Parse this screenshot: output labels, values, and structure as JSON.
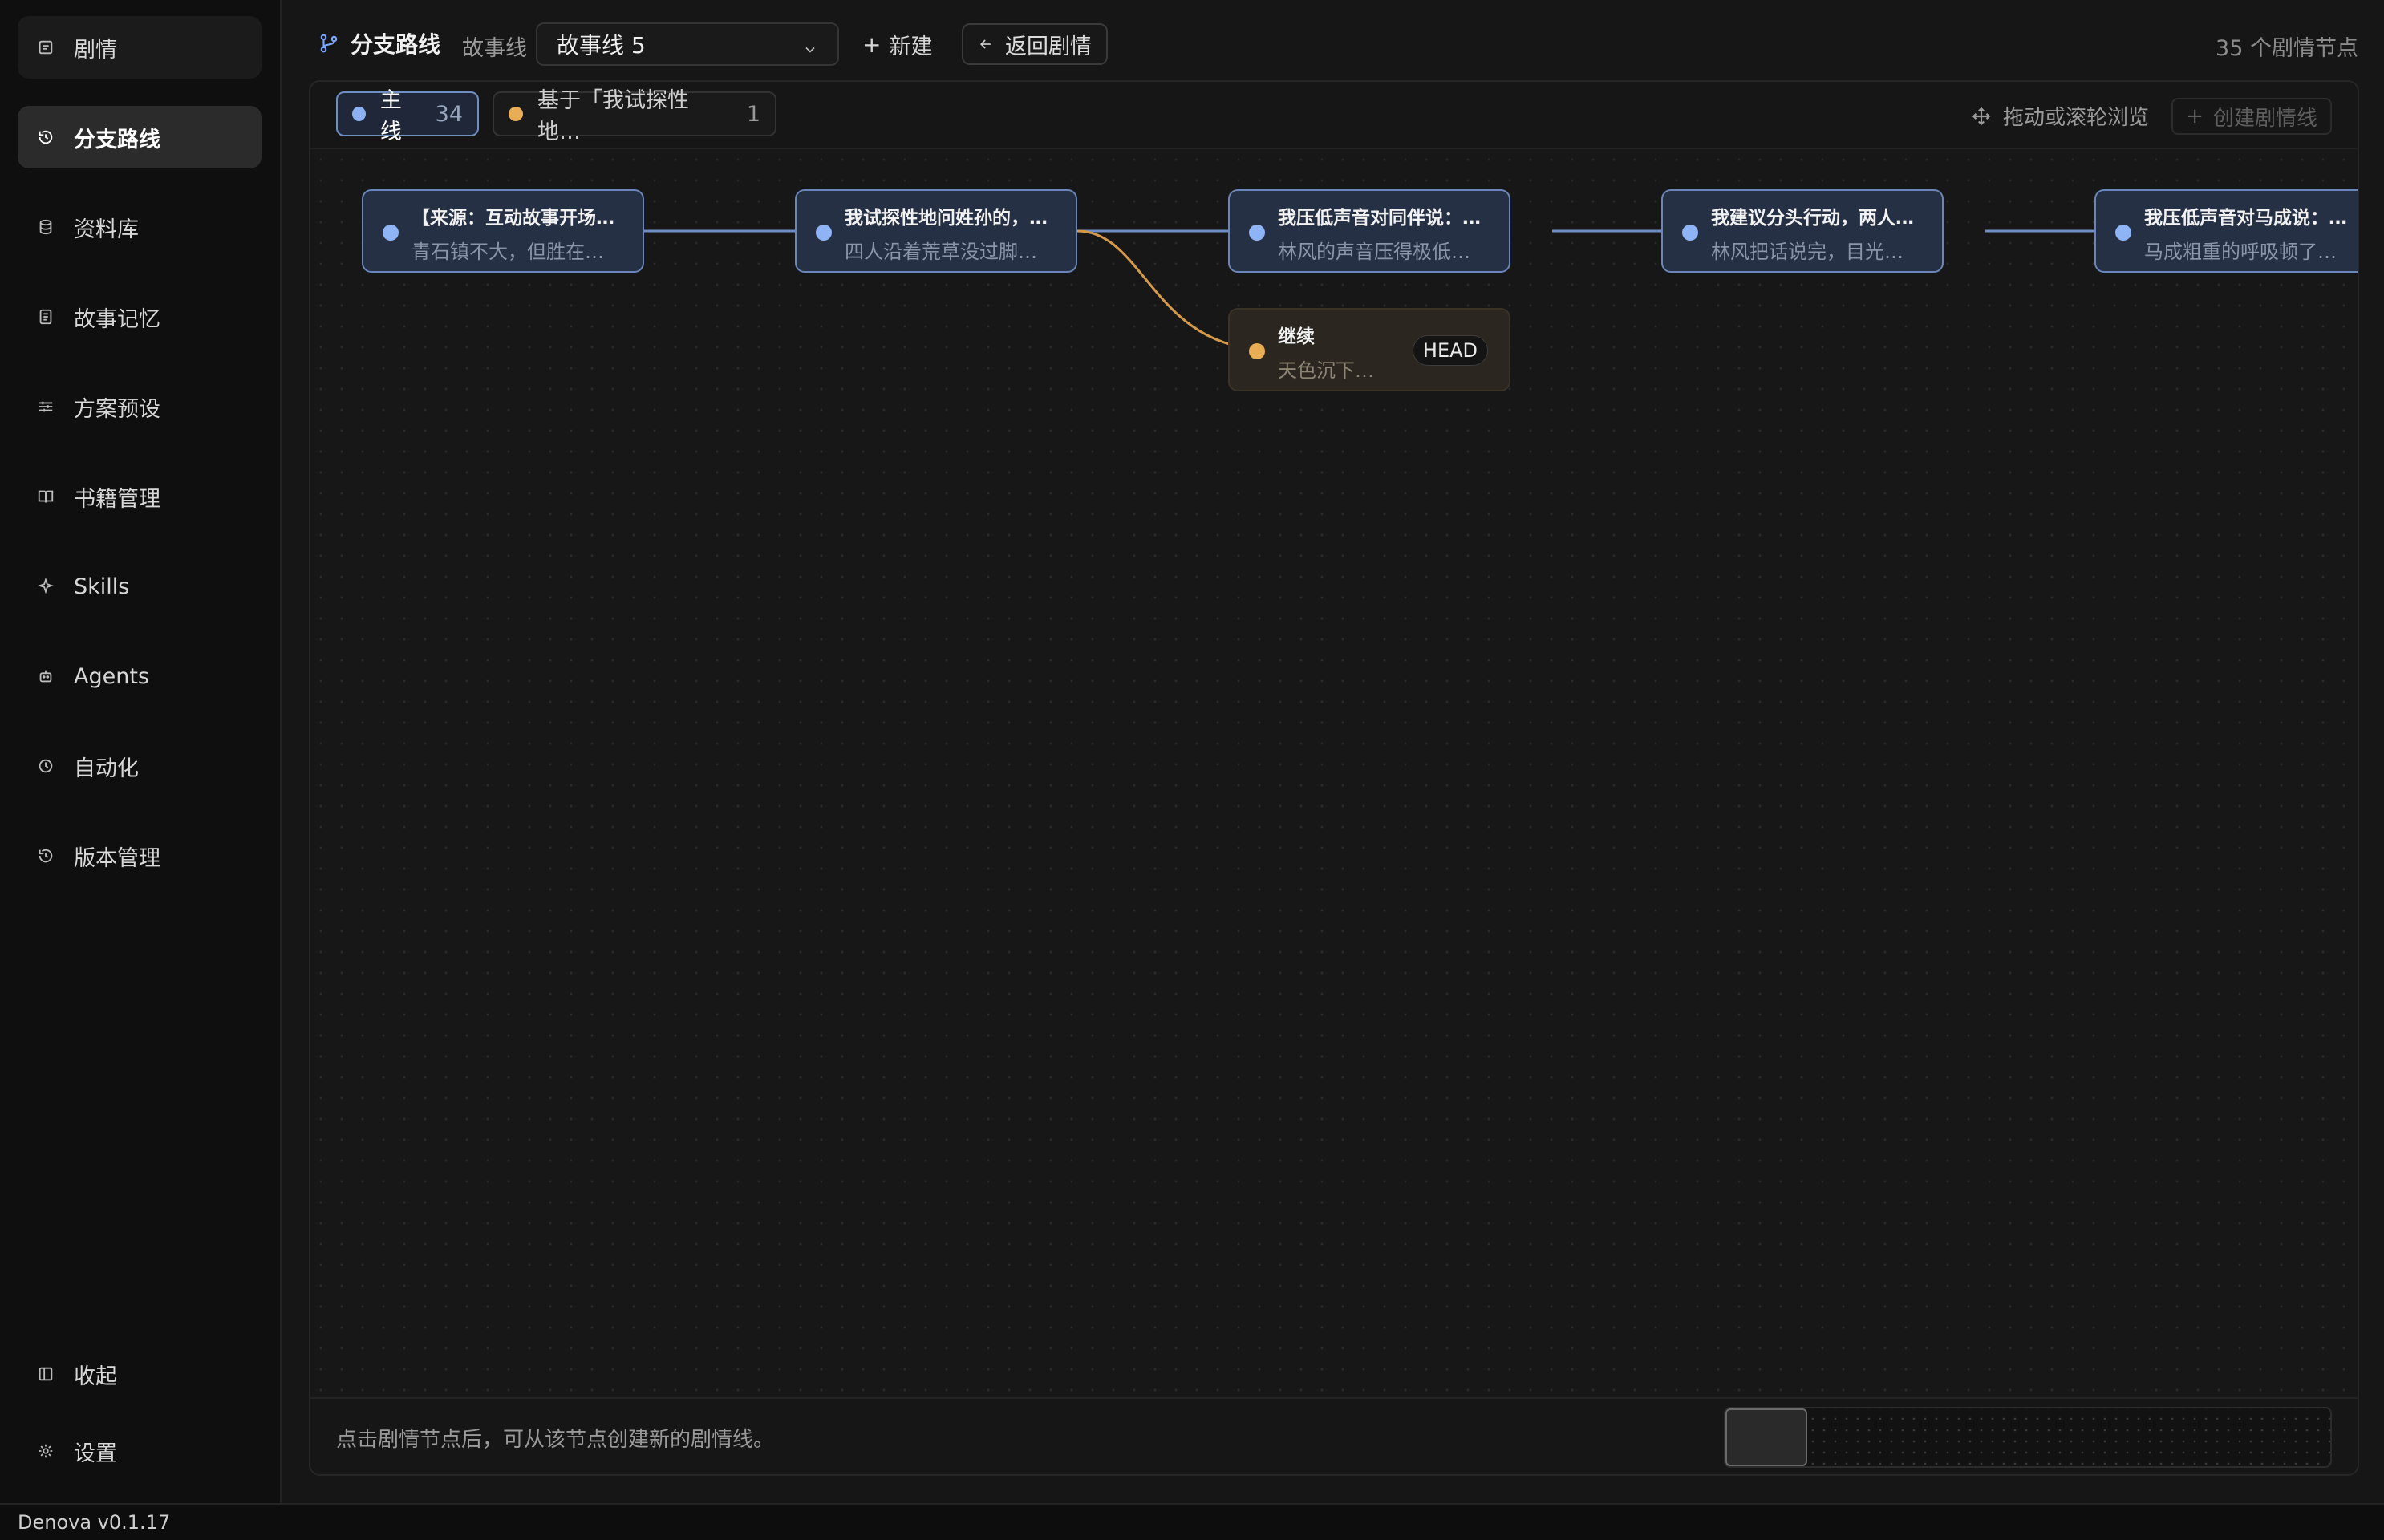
{
  "app": {
    "version": "Denova v0.1.17"
  },
  "sidebar": {
    "items": [
      {
        "label": "剧情",
        "icon": "document-icon"
      },
      {
        "label": "分支路线",
        "icon": "history-icon"
      },
      {
        "label": "资料库",
        "icon": "database-icon"
      },
      {
        "label": "故事记忆",
        "icon": "notebook-icon"
      },
      {
        "label": "方案预设",
        "icon": "sliders-icon"
      },
      {
        "label": "书籍管理",
        "icon": "book-icon"
      },
      {
        "label": "Skills",
        "icon": "sparkle-icon"
      },
      {
        "label": "Agents",
        "icon": "robot-icon"
      },
      {
        "label": "自动化",
        "icon": "clock-icon"
      },
      {
        "label": "版本管理",
        "icon": "history-icon"
      }
    ],
    "collapse_label": "收起",
    "settings_label": "设置"
  },
  "header": {
    "title": "分支路线",
    "storyline_label": "故事线",
    "storyline_selected": "故事线 5",
    "new_label": "新建",
    "back_label": "返回剧情",
    "node_count": "35 个剧情节点"
  },
  "toolbar": {
    "main_tab_label": "主线",
    "main_tab_count": "34",
    "branch_tab_label": "基于「我试探性地…",
    "branch_tab_count": "1",
    "drag_hint": "拖动或滚轮浏览",
    "create_line_label": "创建剧情线"
  },
  "nodes": [
    {
      "title": "【来源：互动故事开场…",
      "subtitle": "青石镇不大，但胜在…"
    },
    {
      "title": "我试探性地问姓孙的，…",
      "subtitle": "四人沿着荒草没过脚…"
    },
    {
      "title": "我压低声音对同伴说：…",
      "subtitle": "林风的声音压得极低…"
    },
    {
      "title": "我建议分头行动，两人…",
      "subtitle": "林风把话说完，目光…"
    },
    {
      "title": "我压低声音对马成说：…",
      "subtitle": "马成粗重的呼吸顿了…"
    }
  ],
  "branch_node": {
    "title": "继续",
    "subtitle": "天色沉下…",
    "badge": "HEAD"
  },
  "colors": {
    "main_line": "#6f8fc4",
    "branch_line": "#d49a4a",
    "main_dot": "#8fb4f5",
    "branch_dot": "#e9ad56"
  },
  "footer": {
    "hint": "点击剧情节点后，可从该节点创建新的剧情线。"
  }
}
